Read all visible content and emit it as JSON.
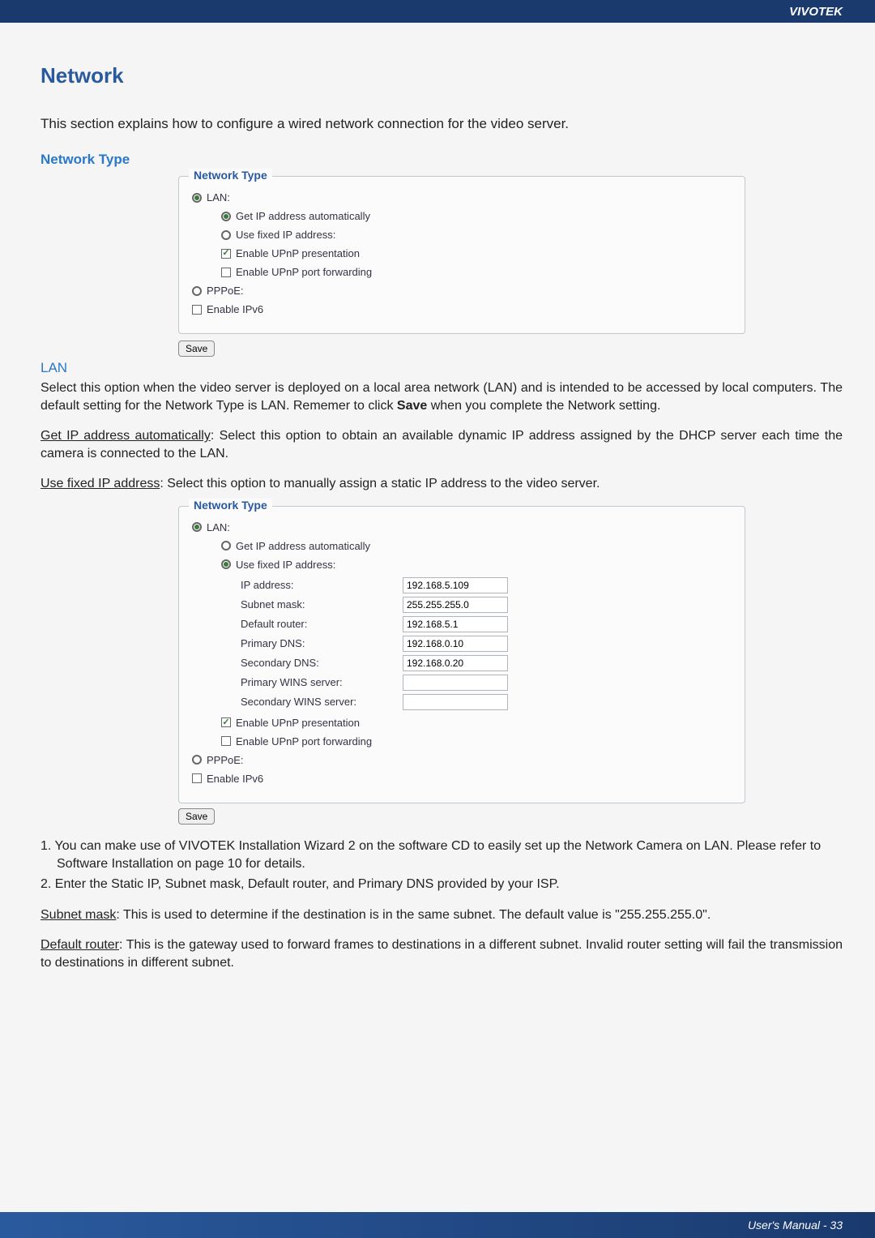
{
  "header": {
    "brand": "VIVOTEK"
  },
  "page": {
    "title": "Network",
    "intro": "This section explains how to configure a wired network connection for the video server.",
    "nt_heading": "Network Type"
  },
  "box1": {
    "legend": "Network Type",
    "lan": "LAN:",
    "getip": "Get IP address automatically",
    "usefixed": "Use fixed IP address:",
    "upnp_pres": "Enable UPnP presentation",
    "upnp_port": "Enable UPnP port forwarding",
    "pppoe": "PPPoE:",
    "ipv6": "Enable IPv6",
    "save": "Save"
  },
  "lan_section": {
    "heading": "LAN",
    "para1_a": "Select this option when the video server is deployed on a local area network (LAN) and is intended to be accessed by local computers. The default setting for the Network Type is LAN. Rememer to click ",
    "para1_b": "Save",
    "para1_c": " when you complete the Network setting.",
    "getip_u": "Get IP address automatically",
    "getip_rest": ": Select this option to obtain an available dynamic IP address assigned by the DHCP server each time the camera is connected to the LAN.",
    "usefixed_u": "Use fixed IP address",
    "usefixed_rest": ": Select this option to manually assign a static IP address to the video server."
  },
  "box2": {
    "legend": "Network Type",
    "lan": "LAN:",
    "getip": "Get IP address automatically",
    "usefixed": "Use fixed IP address:",
    "labels": {
      "ip": "IP address:",
      "subnet": "Subnet mask:",
      "router": "Default router:",
      "pdns": "Primary DNS:",
      "sdns": "Secondary DNS:",
      "pwins": "Primary WINS server:",
      "swins": "Secondary WINS server:"
    },
    "values": {
      "ip": "192.168.5.109",
      "subnet": "255.255.255.0",
      "router": "192.168.5.1",
      "pdns": "192.168.0.10",
      "sdns": "192.168.0.20",
      "pwins": "",
      "swins": ""
    },
    "upnp_pres": "Enable UPnP presentation",
    "upnp_port": "Enable UPnP port forwarding",
    "pppoe": "PPPoE:",
    "ipv6": "Enable IPv6",
    "save": "Save"
  },
  "notes": {
    "item1": "1. You can make use of VIVOTEK Installation Wizard 2 on the software CD to easily set up the Network Camera on LAN. Please refer to Software Installation on page 10 for details.",
    "item2": "2. Enter the Static IP, Subnet mask, Default router, and Primary DNS provided by your ISP.",
    "subnet_u": "Subnet mask",
    "subnet_rest": ": This is used to determine if the destination is in the same subnet. The default value is \"255.255.255.0\".",
    "router_u": "Default router",
    "router_rest": ": This is the gateway used to forward frames to destinations in a different subnet. Invalid router setting will fail the transmission to destinations in different subnet."
  },
  "footer": {
    "text": "User's Manual - 33"
  }
}
